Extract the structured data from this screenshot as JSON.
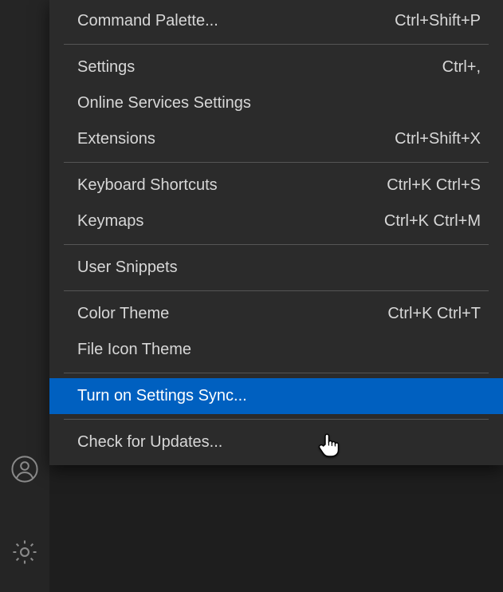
{
  "menu": {
    "groups": [
      [
        {
          "id": "command-palette",
          "label": "Command Palette...",
          "shortcut": "Ctrl+Shift+P"
        }
      ],
      [
        {
          "id": "settings",
          "label": "Settings",
          "shortcut": "Ctrl+,"
        },
        {
          "id": "online-services-settings",
          "label": "Online Services Settings",
          "shortcut": ""
        },
        {
          "id": "extensions",
          "label": "Extensions",
          "shortcut": "Ctrl+Shift+X"
        }
      ],
      [
        {
          "id": "keyboard-shortcuts",
          "label": "Keyboard Shortcuts",
          "shortcut": "Ctrl+K Ctrl+S"
        },
        {
          "id": "keymaps",
          "label": "Keymaps",
          "shortcut": "Ctrl+K Ctrl+M"
        }
      ],
      [
        {
          "id": "user-snippets",
          "label": "User Snippets",
          "shortcut": ""
        }
      ],
      [
        {
          "id": "color-theme",
          "label": "Color Theme",
          "shortcut": "Ctrl+K Ctrl+T"
        },
        {
          "id": "file-icon-theme",
          "label": "File Icon Theme",
          "shortcut": ""
        }
      ],
      [
        {
          "id": "turn-on-settings-sync",
          "label": "Turn on Settings Sync...",
          "shortcut": "",
          "selected": true
        }
      ],
      [
        {
          "id": "check-for-updates",
          "label": "Check for Updates...",
          "shortcut": ""
        }
      ]
    ]
  },
  "activity_bar": {
    "accounts_icon": "accounts",
    "gear_icon": "settings"
  }
}
